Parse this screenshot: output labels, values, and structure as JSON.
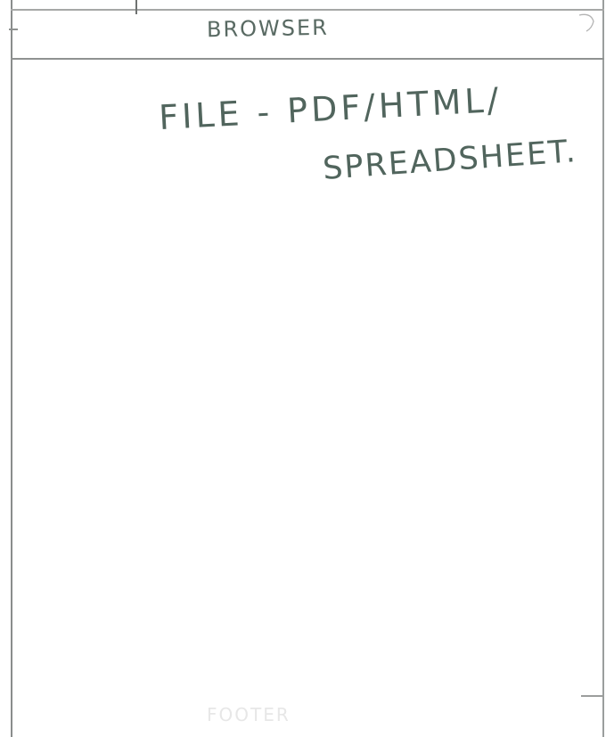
{
  "browser": {
    "title": "BROWSER"
  },
  "content": {
    "line_1": "FILE - PDF/HTML/",
    "line_2": "SPREADSHEET."
  },
  "footer": {
    "faint_text": "FOOTER"
  },
  "icons": {
    "corner": "window-corner-icon"
  },
  "colors": {
    "ink": "#51655d",
    "pencil": "#8f9291",
    "paper": "#ffffff"
  }
}
